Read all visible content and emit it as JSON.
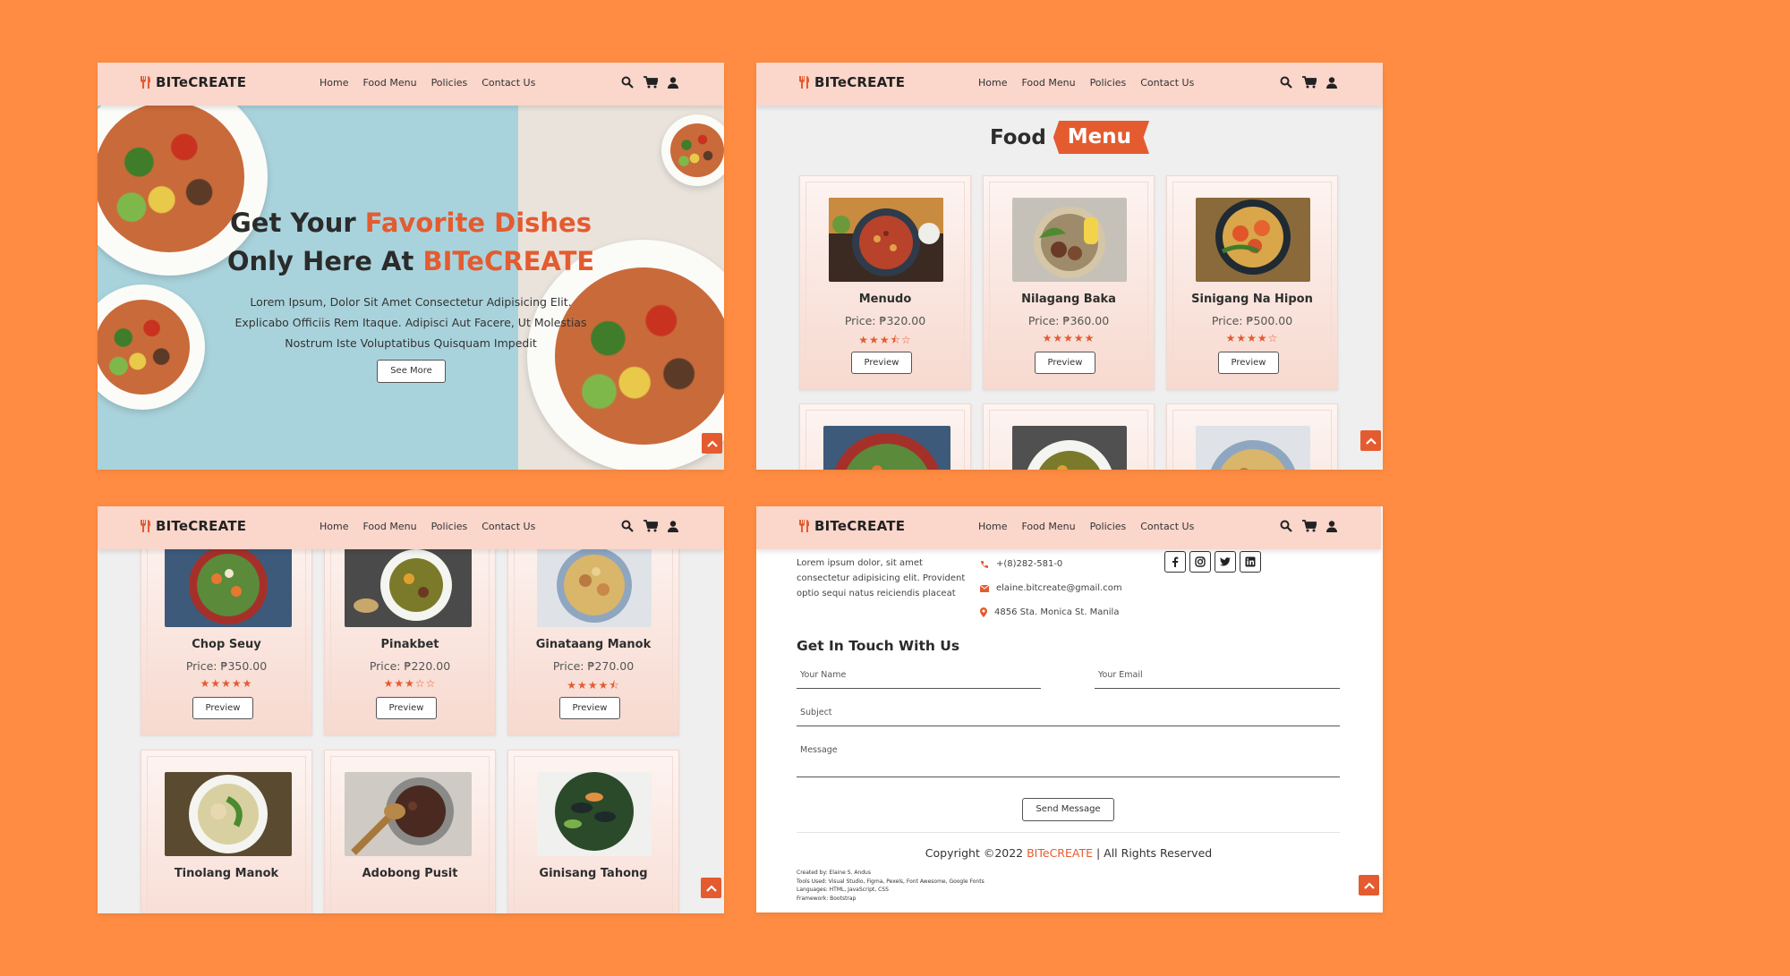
{
  "brand": "BITeCREATE",
  "colors": {
    "background": "#ff8c42",
    "accent": "#e45b30",
    "navbar": "#fad6cb"
  },
  "nav": {
    "items": [
      "Home",
      "Food Menu",
      "Policies",
      "Contact Us"
    ],
    "icons": [
      "search-icon",
      "cart-icon",
      "user-icon"
    ]
  },
  "hero": {
    "line1_start": "Get Your ",
    "line1_accent": "Favorite Dishes",
    "line2_start": "Only Here At ",
    "line2_accent": "BITeCREATE",
    "text": "Lorem Ipsum, Dolor Sit Amet Consectetur Adipisicing Elit. Explicabo Officiis Rem Itaque. Adipisci Aut Facere, Ut Molestias Nostrum Iste Voluptatibus Quisquam Impedit",
    "button": "See More"
  },
  "food_menu": {
    "heading_word1": "Food",
    "heading_word2": "Menu",
    "button": "Preview",
    "dishes": [
      {
        "name": "Menudo",
        "price": "Price: ₱320.00",
        "rating": 3.5,
        "stars": "★★★⯪☆"
      },
      {
        "name": "Nilagang Baka",
        "price": "Price: ₱360.00",
        "rating": 5,
        "stars": "★★★★★"
      },
      {
        "name": "Sinigang Na Hipon",
        "price": "Price: ₱500.00",
        "rating": 4,
        "stars": "★★★★☆"
      },
      {
        "name": "Chop Seuy",
        "price": "Price: ₱350.00",
        "rating": 5,
        "stars": "★★★★★"
      },
      {
        "name": "Pinakbet",
        "price": "Price: ₱220.00",
        "rating": 3,
        "stars": "★★★☆☆"
      },
      {
        "name": "Ginataang Manok",
        "price": "Price: ₱270.00",
        "rating": 4.5,
        "stars": "★★★★⯪"
      },
      {
        "name": "Tinolang Manok"
      },
      {
        "name": "Adobong Pusit"
      },
      {
        "name": "Ginisang Tahong"
      }
    ]
  },
  "contact": {
    "about": "Lorem ipsum dolor, sit amet consectetur adipisicing elit. Provident optio sequi natus reiciendis placeat",
    "phone": "+(8)282-581-0",
    "email": "elaine.bitcreate@gmail.com",
    "address": "4856 Sta. Monica St. Manila",
    "social_icons": [
      "facebook-icon",
      "instagram-icon",
      "twitter-icon",
      "linkedin-icon"
    ],
    "form_title": "Get In Touch With Us",
    "name_placeholder": "Your Name",
    "email_placeholder": "Your Email",
    "subject_placeholder": "Subject",
    "message_placeholder": "Message",
    "send_button": "Send Message",
    "copyright_start": "Copyright ©2022 ",
    "copyright_brand": "BITeCREATE",
    "copyright_end": " | All Rights Reserved",
    "credits": [
      "Created by: Elaine S. Andus",
      "Tools Used: Visual Studio, Figma, Pexels, Font Awesome, Google Fonts",
      "Languages: HTML, JavaScript, CSS",
      "Framework: Bootstrap"
    ]
  }
}
